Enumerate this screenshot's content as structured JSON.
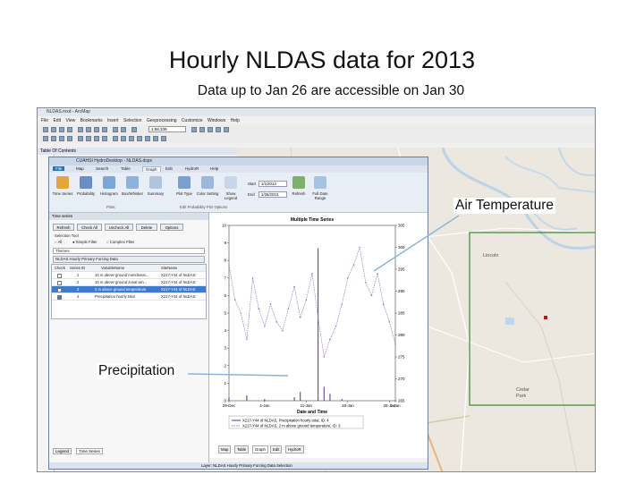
{
  "slide": {
    "title": "Hourly NLDAS data for 2013",
    "subtitle": "Data up to Jan 26 are accessible on Jan 30"
  },
  "callouts": {
    "air_temperature": "Air Temperature",
    "precipitation": "Precipitation"
  },
  "arcmap": {
    "title": "NLDAS.mxd - ArcMap",
    "menu": [
      "File",
      "Edit",
      "View",
      "Bookmarks",
      "Insert",
      "Selection",
      "Geoprocessing",
      "Customize",
      "Windows",
      "Help"
    ],
    "scale": "1:58,339",
    "toc_title": "Table Of Contents",
    "map_labels": {
      "lincoln": "Lincoln",
      "cedar_park": "Cedar Park"
    },
    "colors": {
      "study_area": "#2e8b2e",
      "site_marker": "#d01010"
    }
  },
  "hydrodesktop": {
    "title": "CUAHSI HydroDesktop - NLDAS.dspx",
    "tabs": [
      "File",
      "Map",
      "Search",
      "Table",
      "Graph",
      "Edit",
      "HydroR",
      "Help"
    ],
    "ribbon": {
      "buttons": [
        "Time Series",
        "Probability",
        "Histogram",
        "Box/Whisker",
        "Summary",
        "Plot Type",
        "Color Setting",
        "Show Legend"
      ],
      "group_labels": [
        "Plots",
        "Edit Probability Plot Options"
      ],
      "start_label": "Start",
      "start_value": "1/1/2013",
      "end_label": "End",
      "end_value": "1/26/2013",
      "extra": [
        "Refresh",
        "Full Date Range"
      ]
    },
    "timeseries_panel": {
      "title": "Time series",
      "buttons": [
        "Refresh",
        "Check All",
        "Uncheck All",
        "Delete",
        "Options"
      ],
      "selection_tool": "Selection Tool",
      "radio_all": "All",
      "radio_simple": "Simple Filter",
      "radio_complex": "Complex Filter",
      "filter_label": "Themes",
      "theme": "NLDAS Hourly Primary Forcing Data",
      "columns": [
        "Check",
        "Series ID",
        "VariableName",
        "SiteName"
      ],
      "rows": [
        {
          "checked": false,
          "id": "1",
          "variable": "10 m above ground meridional...",
          "site": "X217-Y44 of NLDAS",
          "selected": false
        },
        {
          "checked": false,
          "id": "2",
          "variable": "10 m above ground zonal win...",
          "site": "X217-Y44 of NLDAS",
          "selected": false
        },
        {
          "checked": true,
          "id": "3",
          "variable": "2 m above ground temperature",
          "site": "X217-Y44 of NLDAS",
          "selected": true
        },
        {
          "checked": true,
          "id": "4",
          "variable": "Precipitation hourly total",
          "site": "X217-Y44 of NLDAS",
          "selected": false
        }
      ],
      "bottom_tabs": [
        "Legend",
        "Time Series"
      ]
    },
    "graph": {
      "bottom_tabs": [
        "Map",
        "Table",
        "Graph",
        "Edit",
        "HydroR"
      ],
      "status": "Layer: NLDAS Hourly Primary Forcing Data Selection"
    }
  },
  "chart_data": {
    "type": "line",
    "title": "Multiple Time Series",
    "xlabel": "Date and Time",
    "x_ticks": [
      "29-Dec",
      "4-Jan",
      "11-Jan",
      "18-Jan",
      "25-Jan",
      "1-Jan"
    ],
    "y_left_ticks": [
      "0",
      "1",
      "2",
      "3",
      "4",
      "5",
      "6",
      "7",
      "8",
      "9",
      "10"
    ],
    "y_right_ticks": [
      "265",
      "270",
      "275",
      "280",
      "285",
      "290",
      "295",
      "300",
      "305"
    ],
    "ylim_left": [
      0,
      10
    ],
    "ylim_right": [
      265,
      305
    ],
    "legend": [
      "X217-Y44 of NLDAS, Precipitation hourly total, ID: 4",
      "X217-Y44 of NLDAS, 2 m above ground temperature, ID: 3"
    ],
    "series": [
      {
        "name": "Precipitation hourly total",
        "axis": "left",
        "color": "#5a2d8c",
        "x": [
          0,
          1,
          2,
          3,
          4,
          5,
          6,
          7,
          8,
          9,
          10,
          11,
          12,
          13,
          14,
          15,
          16,
          17,
          18,
          19,
          20,
          21,
          22,
          23,
          24,
          25,
          26,
          27,
          28
        ],
        "y": [
          0.2,
          0,
          0,
          0.3,
          0,
          0,
          0.1,
          0,
          0,
          0,
          0,
          0.2,
          0.5,
          0,
          0,
          8.7,
          0.8,
          0.4,
          0,
          0.1,
          0,
          0,
          0,
          0,
          0,
          0,
          0,
          0,
          0
        ]
      },
      {
        "name": "2 m above ground temperature",
        "axis": "right",
        "color": "#9a7bb8",
        "x": [
          0,
          1,
          2,
          3,
          4,
          5,
          6,
          7,
          8,
          9,
          10,
          11,
          12,
          13,
          14,
          15,
          16,
          17,
          18,
          19,
          20,
          21,
          22,
          23,
          24,
          25,
          26,
          27,
          28
        ],
        "y": [
          296,
          288,
          285,
          279,
          293,
          286,
          282,
          287,
          283,
          281,
          286,
          291,
          284,
          288,
          294,
          284,
          275,
          279,
          282,
          287,
          293,
          296,
          300,
          292,
          289,
          294,
          287,
          283,
          278
        ]
      }
    ]
  }
}
